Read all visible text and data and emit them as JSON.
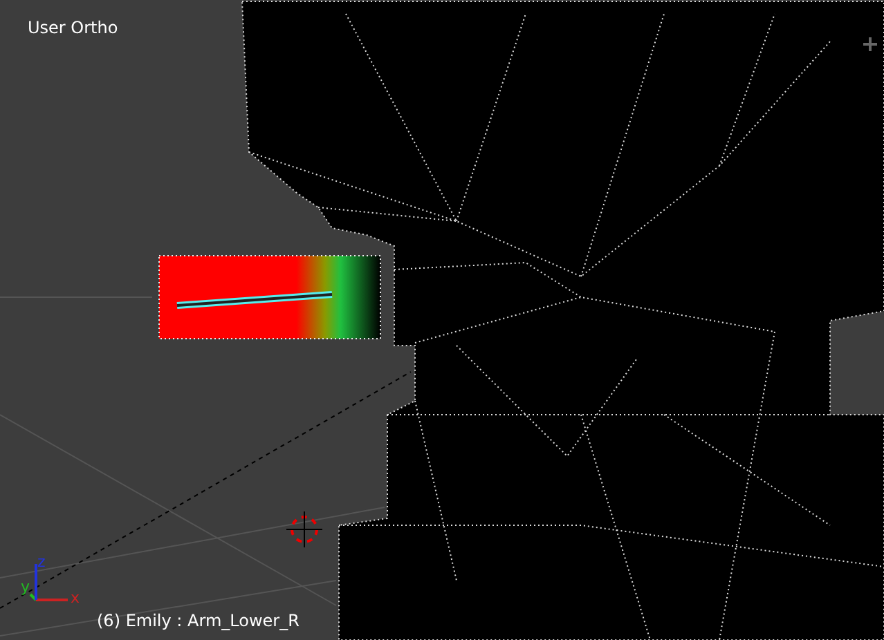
{
  "viewport": {
    "title": "User Ortho",
    "status": "(6) Emily : Arm_Lower_R"
  },
  "axes": [
    {
      "label": "x",
      "color": "#cc2222"
    },
    {
      "label": "y",
      "color": "#22bb22"
    },
    {
      "label": "z",
      "color": "#2233dd"
    }
  ]
}
